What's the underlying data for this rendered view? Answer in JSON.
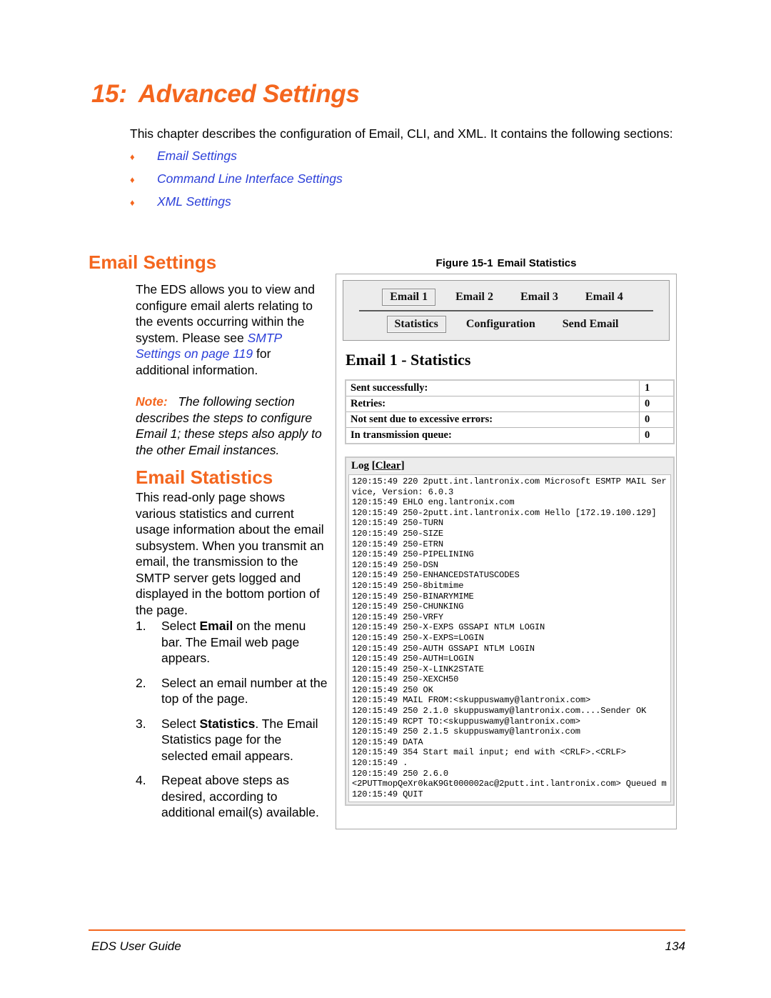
{
  "colors": {
    "accent_orange": "#F4661E",
    "link_blue": "#2B3FD9",
    "panel_gray": "#ECECEC"
  },
  "chapter": {
    "number": "15:",
    "title": "Advanced Settings",
    "intro": "This chapter describes the configuration of Email, CLI, and XML. It contains the following sections:",
    "section_links": [
      "Email Settings",
      "Command Line Interface Settings",
      "XML Settings"
    ],
    "bullet_glyph": "♦"
  },
  "email_settings": {
    "heading": "Email Settings",
    "body_part1": "The EDS allows you to view and configure email alerts relating to the events occurring within the system.  Please see ",
    "body_link": "SMTP Settings on page 119",
    "body_part2": " for additional information.",
    "note_label": "Note:",
    "note_text": "The following section describes the steps to configure Email 1; these steps also apply to the other Email instances."
  },
  "email_statistics": {
    "heading": "Email Statistics",
    "description": "This read-only page shows various statistics and current usage information about the email subsystem. When you transmit an email, the transmission to the SMTP server gets logged and displayed in the bottom portion of the page.",
    "steps": [
      {
        "num": "1.",
        "pre": "Select ",
        "bold": "Email",
        "post": " on the menu bar.  The Email web page appears."
      },
      {
        "num": "2.",
        "pre": "Select an email number at the top of the page.",
        "bold": "",
        "post": ""
      },
      {
        "num": "3.",
        "pre": "Select ",
        "bold": "Statistics",
        "post": ". The Email Statistics page for the selected email appears."
      },
      {
        "num": "4.",
        "pre": "Repeat above steps as desired, according to additional email(s) available.",
        "bold": "",
        "post": ""
      }
    ]
  },
  "figure": {
    "caption_number": "Figure 15-1",
    "caption_title": "Email Statistics",
    "nav_row1": [
      {
        "label": "Email 1",
        "selected": true
      },
      {
        "label": "Email 2",
        "selected": false
      },
      {
        "label": "Email 3",
        "selected": false
      },
      {
        "label": "Email 4",
        "selected": false
      }
    ],
    "nav_row2": [
      {
        "label": "Statistics",
        "selected": true
      },
      {
        "label": "Configuration",
        "selected": false
      },
      {
        "label": "Send Email",
        "selected": false
      }
    ],
    "page_heading": "Email 1 - Statistics",
    "stats_rows": [
      {
        "label": "Sent successfully:",
        "value": "1"
      },
      {
        "label": "Retries:",
        "value": "0"
      },
      {
        "label": "Not sent due to excessive errors:",
        "value": "0"
      },
      {
        "label": "In transmission queue:",
        "value": "0"
      }
    ],
    "log_title": "Log [",
    "log_clear_label": "Clear",
    "log_title_end": "]",
    "log_text": "120:15:49 220 2putt.int.lantronix.com Microsoft ESMTP MAIL Service, Version: 6.0.3\n120:15:49 EHLO eng.lantronix.com\n120:15:49 250-2putt.int.lantronix.com Hello [172.19.100.129]\n120:15:49 250-TURN\n120:15:49 250-SIZE\n120:15:49 250-ETRN\n120:15:49 250-PIPELINING\n120:15:49 250-DSN\n120:15:49 250-ENHANCEDSTATUSCODES\n120:15:49 250-8bitmime\n120:15:49 250-BINARYMIME\n120:15:49 250-CHUNKING\n120:15:49 250-VRFY\n120:15:49 250-X-EXPS GSSAPI NTLM LOGIN\n120:15:49 250-X-EXPS=LOGIN\n120:15:49 250-AUTH GSSAPI NTLM LOGIN\n120:15:49 250-AUTH=LOGIN\n120:15:49 250-X-LINK2STATE\n120:15:49 250-XEXCH50\n120:15:49 250 OK\n120:15:49 MAIL FROM:<skuppuswamy@lantronix.com>\n120:15:49 250 2.1.0 skuppuswamy@lantronix.com....Sender OK\n120:15:49 RCPT TO:<skuppuswamy@lantronix.com>\n120:15:49 250 2.1.5 skuppuswamy@lantronix.com\n120:15:49 DATA\n120:15:49 354 Start mail input; end with <CRLF>.<CRLF>\n120:15:49 .\n120:15:49 250 2.6.0\n<2PUTTmopQeXr0kaK9Gt000002ac@2putt.int.lantronix.com> Queued m\n120:15:49 QUIT"
  },
  "footer": {
    "left": "EDS User Guide",
    "right": "134"
  }
}
